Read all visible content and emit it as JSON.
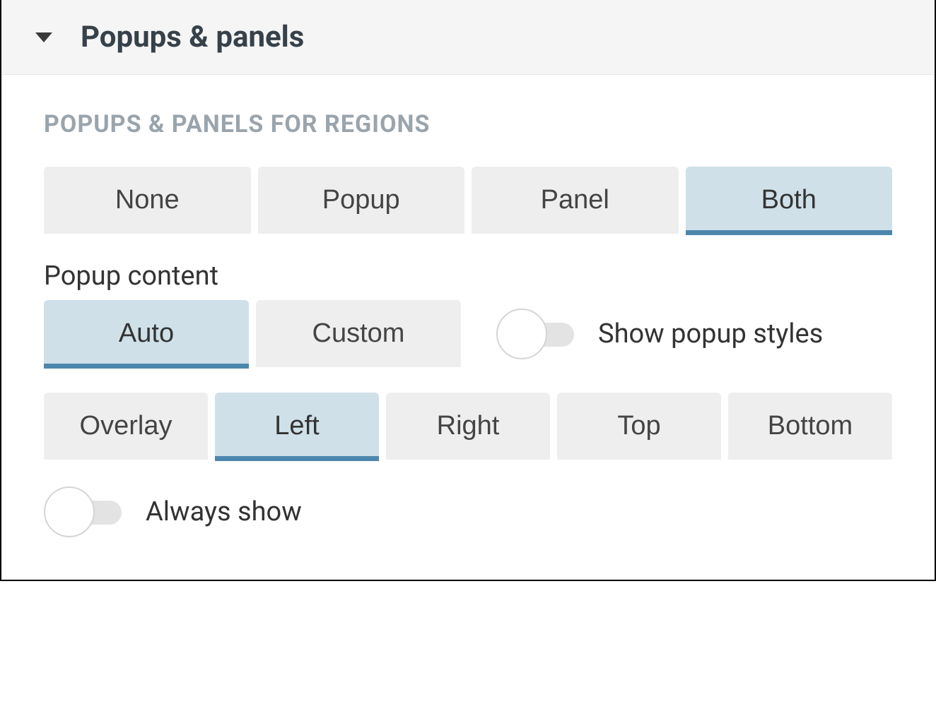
{
  "header": {
    "title": "Popups & panels"
  },
  "section": {
    "label": "POPUPS & PANELS FOR REGIONS"
  },
  "mode": {
    "options": {
      "none": "None",
      "popup": "Popup",
      "panel": "Panel",
      "both": "Both"
    },
    "selected": "both"
  },
  "popup_content": {
    "label": "Popup content",
    "options": {
      "auto": "Auto",
      "custom": "Custom"
    },
    "selected": "auto"
  },
  "show_popup_styles": {
    "label": "Show popup styles",
    "value": false
  },
  "position": {
    "options": {
      "overlay": "Overlay",
      "left": "Left",
      "right": "Right",
      "top": "Top",
      "bottom": "Bottom"
    },
    "selected": "left"
  },
  "always_show": {
    "label": "Always show",
    "value": false
  }
}
